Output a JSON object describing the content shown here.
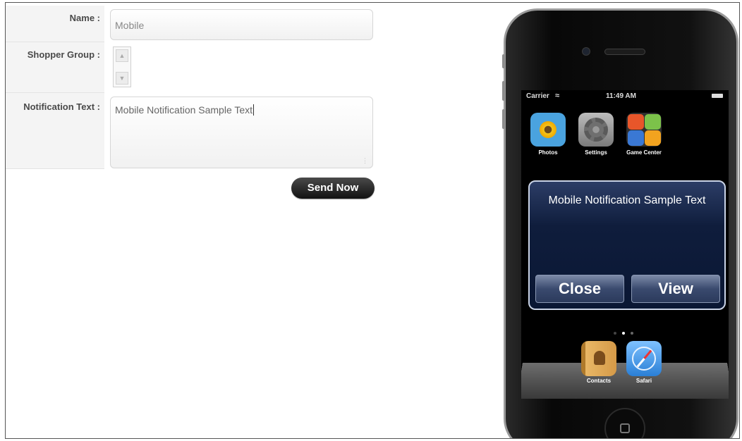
{
  "form": {
    "name_label": "Name :",
    "name_value": "Mobile",
    "shopper_label": "Shopper Group :",
    "notification_label": "Notification Text :",
    "notification_value": "Mobile Notification Sample Text",
    "send_button": "Send Now"
  },
  "phone": {
    "status": {
      "carrier": "Carrier",
      "time": "11:49 AM"
    },
    "apps": [
      {
        "label": "Photos",
        "icon": "photos-icon"
      },
      {
        "label": "Settings",
        "icon": "settings-icon"
      },
      {
        "label": "Game Center",
        "icon": "game-center-icon"
      }
    ],
    "alert": {
      "message": "Mobile Notification Sample Text",
      "close_label": "Close",
      "view_label": "View"
    },
    "dock": [
      {
        "label": "Contacts",
        "icon": "contacts-icon"
      },
      {
        "label": "Safari",
        "icon": "safari-icon"
      }
    ]
  },
  "colors": {
    "alert_bg": "#0f1d3c",
    "button_dark": "#111111"
  }
}
